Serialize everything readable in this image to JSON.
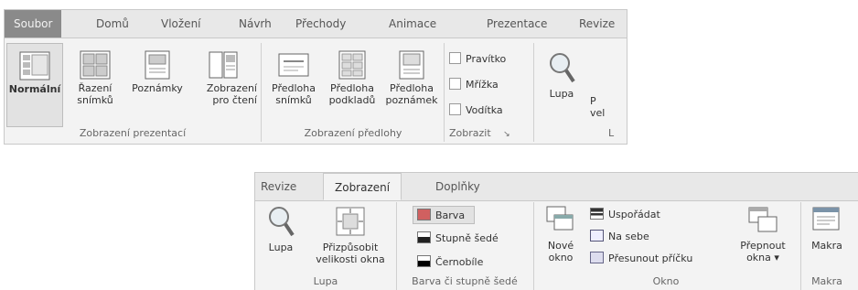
{
  "ribbon1": {
    "tabs": [
      "Soubor",
      "Domů",
      "Vložení",
      "Návrh",
      "Přechody",
      "Animace",
      "Prezentace",
      "Revize"
    ],
    "groups": {
      "prezentaci": "Zobrazení prezentací",
      "predlohy": "Zobrazení předlohy",
      "zobrazit": "Zobrazit",
      "lupa_partial": "L"
    },
    "buttons": {
      "normalni": "Normální",
      "razeni": "Řazení\nsnímků",
      "poznamky": "Poznámky",
      "zobrazeni_cteni": "Zobrazení\npro čtení",
      "predloha_snimku": "Předloha\nsnímků",
      "predloha_podkladu": "Předloha\npodkladů",
      "predloha_poznamek": "Předloha\npoznámek",
      "lupa": "Lupa",
      "prizpusobit_partial": "P\nvel"
    },
    "checkboxes": [
      "Pravítko",
      "Mřížka",
      "Vodítka"
    ]
  },
  "ribbon2": {
    "tabs": [
      "Revize",
      "Zobrazení",
      "Doplňky"
    ],
    "groups": {
      "lupa": "Lupa",
      "barva": "Barva či stupně šedé",
      "okno": "Okno",
      "makra": "Makra"
    },
    "buttons": {
      "lupa": "Lupa",
      "prizpusobit": "Přizpůsobit\nvelikosti okna",
      "nove_okno": "Nové\nokno",
      "prepnout": "Přepnout\nokna ▾",
      "makra": "Makra"
    },
    "color_options": [
      "Barva",
      "Stupně šedé",
      "Černobíle"
    ],
    "window_options": [
      "Uspořádat",
      "Na sebe",
      "Přesunout příčku"
    ]
  }
}
